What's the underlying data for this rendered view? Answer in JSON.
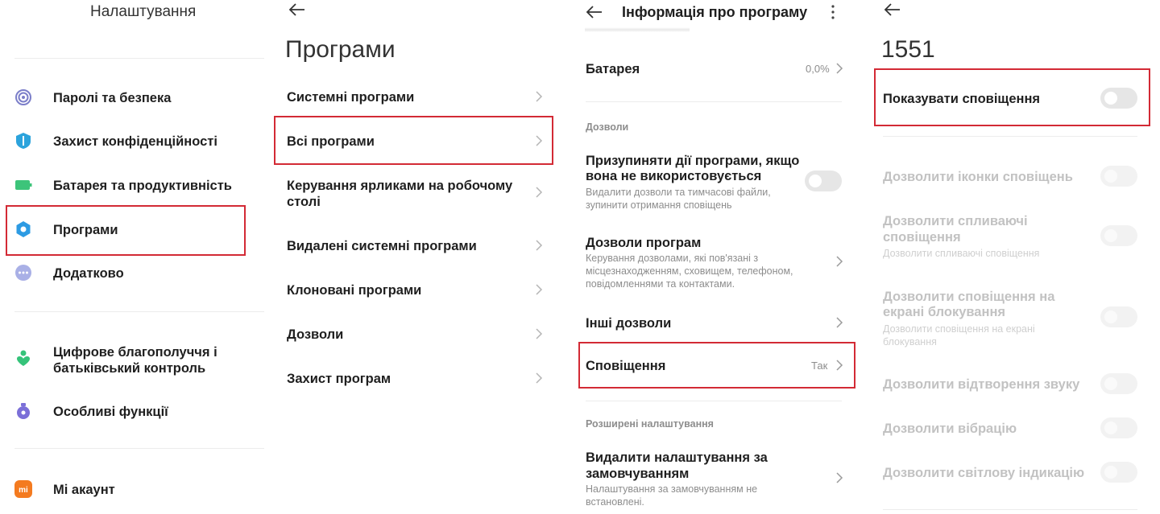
{
  "panel1": {
    "title": "Налаштування",
    "items": [
      {
        "label": "Паролі та безпека",
        "icon": "fingerprint-icon"
      },
      {
        "label": "Захист конфіденційності",
        "icon": "privacy-shield-icon"
      },
      {
        "label": "Батарея та продуктивність",
        "icon": "battery-icon"
      },
      {
        "label": "Програми",
        "icon": "apps-gear-icon"
      },
      {
        "label": "Додатково",
        "icon": "more-dots-icon"
      },
      {
        "label_line1": "Цифрове благополуччя і",
        "label_line2": "батьківський контроль",
        "icon": "wellbeing-icon"
      },
      {
        "label": "Особливі функції",
        "icon": "special-features-icon"
      },
      {
        "label": "Мі акаунт",
        "icon": "mi-account-icon"
      }
    ]
  },
  "panel2": {
    "title": "Програми",
    "items": [
      {
        "label": "Системні програми"
      },
      {
        "label": "Всі програми"
      },
      {
        "label_line1": "Керування ярликами на робочому",
        "label_line2": "столі"
      },
      {
        "label": "Видалені системні програми"
      },
      {
        "label": "Клоновані програми"
      },
      {
        "label": "Дозволи"
      },
      {
        "label": "Захист програм"
      }
    ]
  },
  "panel3": {
    "title": "Інформація про програму",
    "battery": {
      "label": "Батарея",
      "value": "0,0%"
    },
    "section_permissions": "Дозволи",
    "pause": {
      "line1": "Призупиняти дії програми, якщо",
      "line2": "вона не використовується",
      "sub1": "Видалити дозволи та тимчасові файли,",
      "sub2": "зупинити отримання сповіщень"
    },
    "app_permissions": {
      "label": "Дозволи програм",
      "sub1": "Керування дозволами, які пов'язані з",
      "sub2": "місцезнаходженням, сховищем, телефоном,",
      "sub3": "повідомленнями та контактами."
    },
    "other_permissions": {
      "label": "Інші дозволи"
    },
    "notifications": {
      "label": "Сповіщення",
      "value": "Так"
    },
    "section_advanced": "Розширені налаштування",
    "clear_defaults": {
      "line1": "Видалити налаштування за",
      "line2": "замовчуванням",
      "sub1": "Налаштування за замовчуванням не",
      "sub2": "встановлені."
    }
  },
  "panel4": {
    "title": "1551",
    "show_notifications": "Показувати сповіщення",
    "items": [
      {
        "label": "Дозволити іконки сповіщень"
      },
      {
        "line1": "Дозволити спливаючі",
        "line2": "сповіщення",
        "sub1": "Дозволити спливаючі сповіщення"
      },
      {
        "line1": "Дозволити сповіщення на",
        "line2": "екрані блокування",
        "sub1": "Дозволити сповіщення на екрані",
        "sub2": "блокування"
      },
      {
        "label": "Дозволити відтворення звуку"
      },
      {
        "label": "Дозволити вібрацію"
      },
      {
        "label": "Дозволити світлову індикацію"
      }
    ]
  },
  "colors": {
    "highlight": "#d32a35"
  }
}
